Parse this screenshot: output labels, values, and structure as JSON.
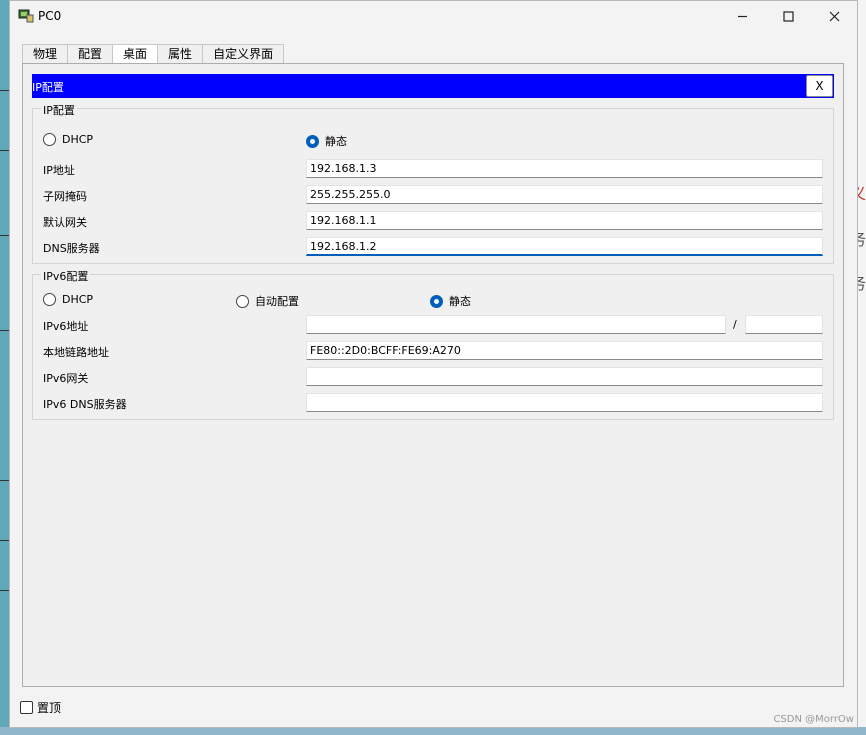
{
  "window": {
    "title": "PC0"
  },
  "tabs": [
    "物理",
    "配置",
    "桌面",
    "属性",
    "自定义界面"
  ],
  "active_tab": "桌面",
  "dialog": {
    "title": "IP配置",
    "close_label": "X"
  },
  "ipv4": {
    "legend": "IP配置",
    "dhcp_label": "DHCP",
    "static_label": "静态",
    "selected": "static",
    "ip_label": "IP地址",
    "ip_value": "192.168.1.3",
    "mask_label": "子网掩码",
    "mask_value": "255.255.255.0",
    "gateway_label": "默认网关",
    "gateway_value": "192.168.1.1",
    "dns_label": "DNS服务器",
    "dns_value": "192.168.1.2"
  },
  "ipv6": {
    "legend": "IPv6配置",
    "dhcp_label": "DHCP",
    "auto_label": "自动配置",
    "static_label": "静态",
    "selected": "static",
    "addr_label": "IPv6地址",
    "addr_value": "",
    "prefix_sep": "/",
    "prefix_value": "",
    "link_local_label": "本地链路地址",
    "link_local_value": "FE80::2D0:BCFF:FE69:A270",
    "gateway_label": "IPv6网关",
    "gateway_value": "",
    "dns_label": "IPv6 DNS服务器",
    "dns_value": ""
  },
  "footer": {
    "pin_label": "置顶",
    "pin_checked": false
  },
  "watermark": "CSDN @MorrOw",
  "background_glyphs": [
    "义",
    "务",
    "务"
  ],
  "colors": {
    "dialog_header": "#0000ff",
    "radio_selected": "#005fb8",
    "focus_underline": "#005fb8"
  }
}
